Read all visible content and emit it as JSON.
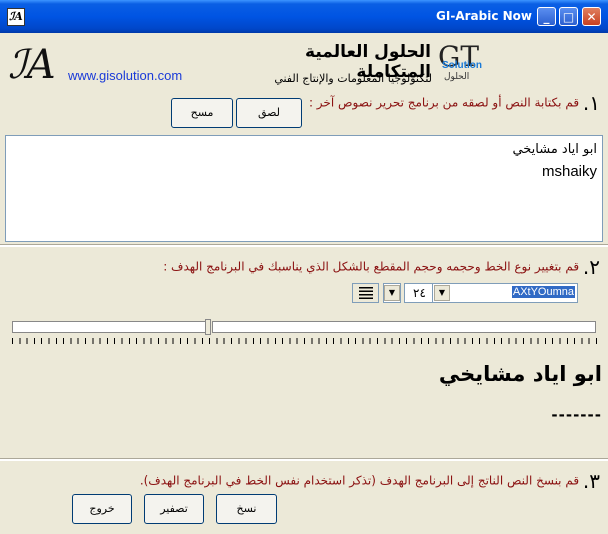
{
  "window": {
    "title": "GI-Arabic Now",
    "min_label": "_",
    "max_label": "□",
    "close_label": "✕",
    "icon_glyph": "ℐA"
  },
  "header": {
    "logo_text": "ℐA",
    "url": "www.gisolution.com",
    "company_name": "الحلول العالمية المتكاملة",
    "company_subtitle": "لتكنولوجيا المعلومات والإنتاج الفني",
    "logo_gt": "GT",
    "logo_solution": "Solution",
    "logo_arabic": "الحلول"
  },
  "step1": {
    "number": "١.",
    "instruction": "قم بكتابة النص أو لصقه من برنامج تحرير نصوص آخر :",
    "paste_label": "لصق",
    "clear_label": "مسح"
  },
  "editor": {
    "line1": "ابو اياد مشايخي",
    "line2": "mshaiky"
  },
  "step2": {
    "number": "٢.",
    "instruction": "قم بتغيير نوع الخط وحجمه وحجم المقطع بالشكل الذي يناسبك في البرنامج الهدف :",
    "font_name": "AXtYOumna",
    "font_size": "٢٤"
  },
  "preview": {
    "line1": "ابو اياد مشايخي",
    "line2": "-------"
  },
  "step3": {
    "number": "٣.",
    "instruction": "قم بنسخ النص الناتج إلى البرنامج الهدف (تذكر استخدام نفس الخط في البرنامج الهدف).",
    "copy_label": "نسخ",
    "reset_label": "تصفير",
    "exit_label": "خروج"
  }
}
